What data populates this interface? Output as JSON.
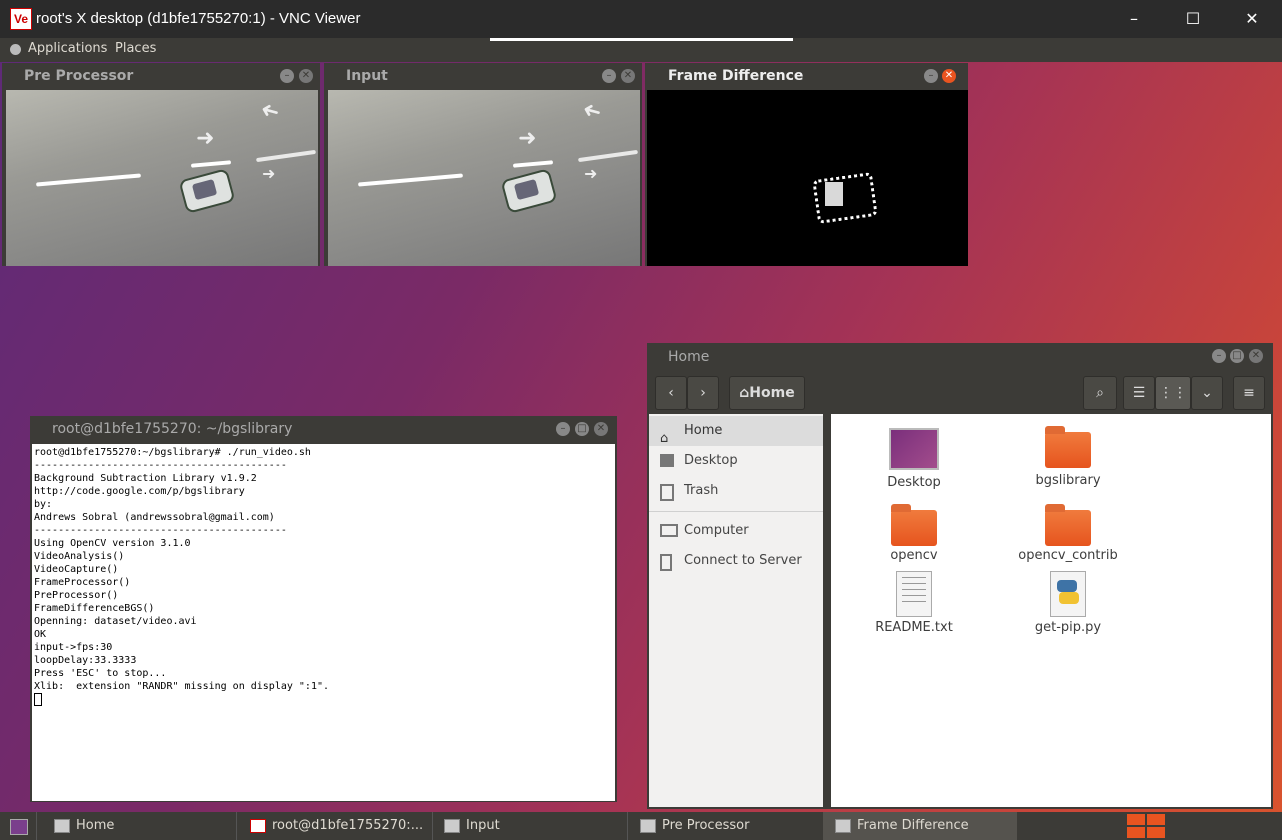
{
  "vnc": {
    "title": "root's X desktop (d1bfe1755270:1) - VNC Viewer",
    "logo": "Ve",
    "minimize": "–",
    "maximize": "☐",
    "close": "✕"
  },
  "top_panel": {
    "applications": "Applications",
    "places": "Places"
  },
  "windows": {
    "pre_processor": {
      "title": "Pre Processor"
    },
    "input": {
      "title": "Input"
    },
    "frame_difference": {
      "title": "Frame Difference"
    }
  },
  "terminal": {
    "title": "root@d1bfe1755270: ~/bgslibrary",
    "lines": [
      "root@d1bfe1755270:~/bgslibrary# ./run_video.sh",
      "------------------------------------------",
      "Background Subtraction Library v1.9.2",
      "http://code.google.com/p/bgslibrary",
      "by:",
      "Andrews Sobral (andrewssobral@gmail.com)",
      "------------------------------------------",
      "Using OpenCV version 3.1.0",
      "VideoAnalysis()",
      "VideoCapture()",
      "FrameProcessor()",
      "PreProcessor()",
      "FrameDifferenceBGS()",
      "Openning: dataset/video.avi",
      "OK",
      "input->fps:30",
      "loopDelay:33.3333",
      "Press 'ESC' to stop...",
      "Xlib:  extension \"RANDR\" missing on display \":1\"."
    ]
  },
  "files": {
    "title": "Home",
    "path_button": "Home",
    "sidebar": [
      {
        "label": "Home",
        "icon": "home-icon"
      },
      {
        "label": "Desktop",
        "icon": "desktop-icon"
      },
      {
        "label": "Trash",
        "icon": "trash-icon"
      },
      {
        "label": "Computer",
        "icon": "computer-icon"
      },
      {
        "label": "Connect to Server",
        "icon": "server-icon"
      }
    ],
    "items": [
      {
        "name": "Desktop",
        "type": "desktop-folder"
      },
      {
        "name": "bgslibrary",
        "type": "folder"
      },
      {
        "name": "opencv",
        "type": "folder"
      },
      {
        "name": "opencv_contrib",
        "type": "folder"
      },
      {
        "name": "README.txt",
        "type": "text-file"
      },
      {
        "name": "get-pip.py",
        "type": "python-file"
      }
    ]
  },
  "taskbar": {
    "items": [
      {
        "label": "Home"
      },
      {
        "label": "root@d1bfe1755270:..."
      },
      {
        "label": "Input"
      },
      {
        "label": "Pre Processor"
      },
      {
        "label": "Frame Difference"
      }
    ]
  },
  "colors": {
    "accent": "#e95420",
    "panel": "#3c3b37"
  }
}
